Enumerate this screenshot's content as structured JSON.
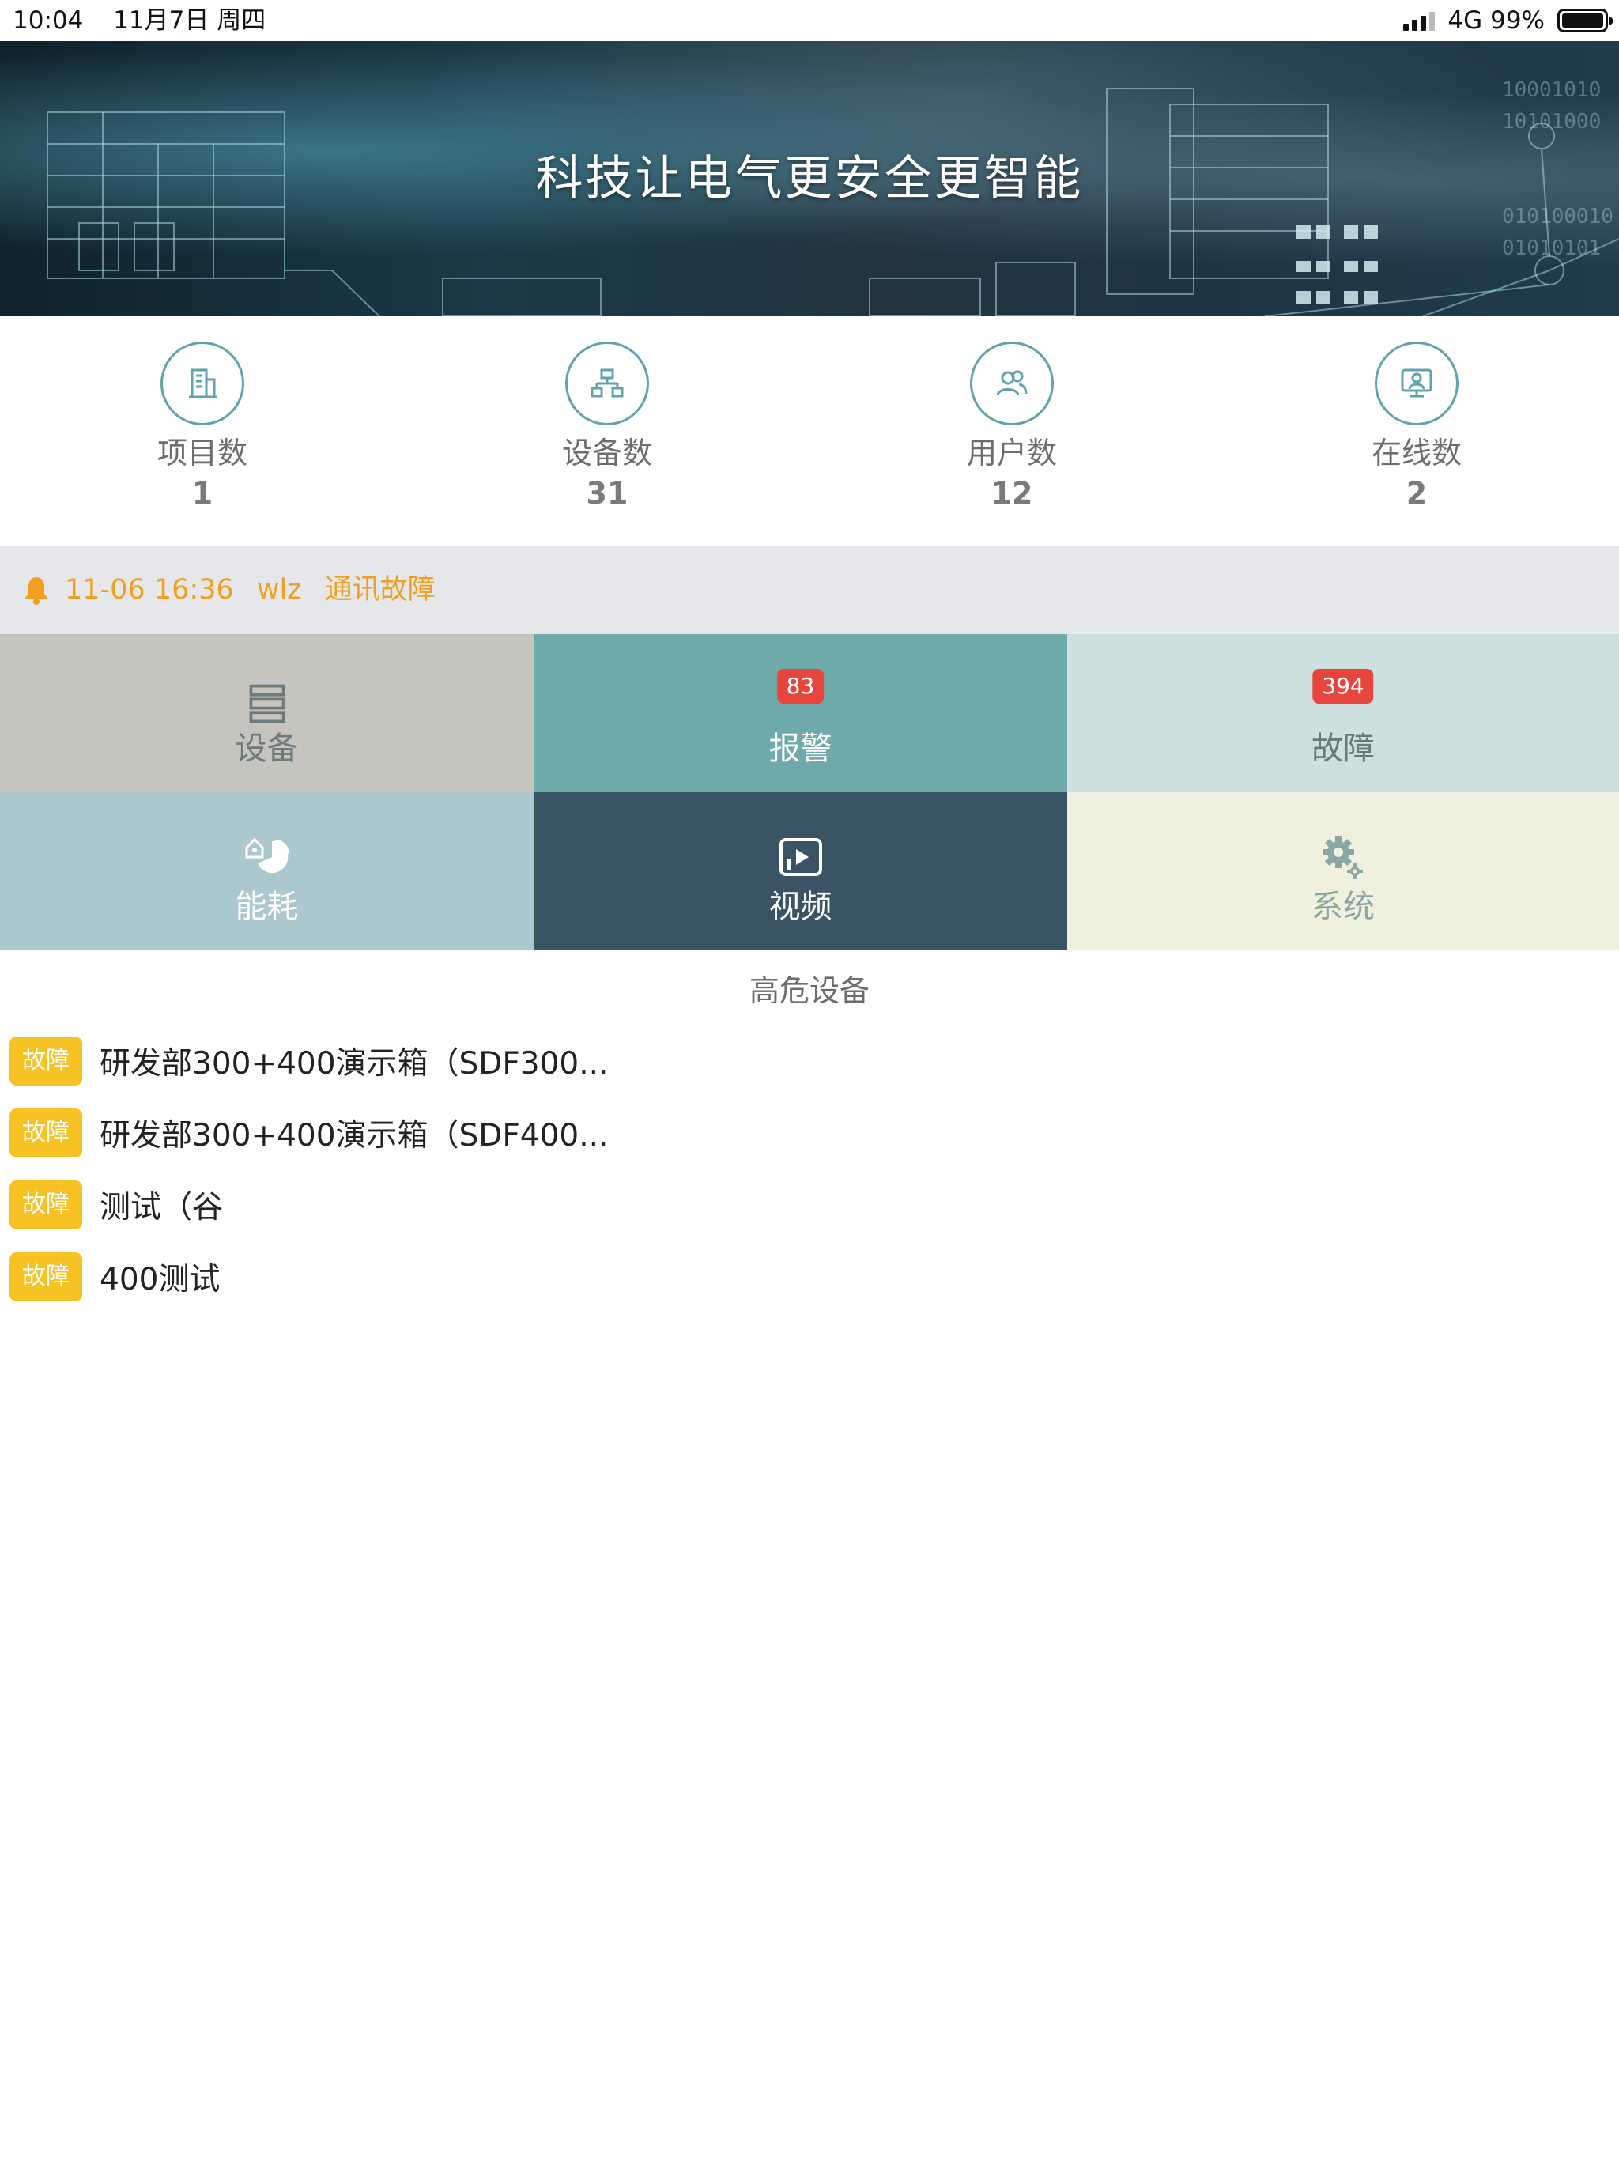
{
  "status_bar": {
    "time": "10:04",
    "date": "11月7日 周四",
    "network": "4G",
    "battery": "99%"
  },
  "banner": {
    "title": "科技让电气更安全更智能"
  },
  "stats": [
    {
      "icon": "building-icon",
      "label": "项目数",
      "value": "1"
    },
    {
      "icon": "network-tree-icon",
      "label": "设备数",
      "value": "31"
    },
    {
      "icon": "users-icon",
      "label": "用户数",
      "value": "12"
    },
    {
      "icon": "online-monitor-icon",
      "label": "在线数",
      "value": "2"
    }
  ],
  "alert": {
    "icon": "bell-icon",
    "time": "11-06 16:36",
    "user": "wlz",
    "message": "通讯故障"
  },
  "tiles": [
    {
      "label": "设备",
      "icon": "device-list-icon",
      "bg": "#c6c5bd",
      "fg": "#6f7b7b"
    },
    {
      "label": "报警",
      "badge": "83",
      "bg": "#6faaab",
      "fg": "#ffffff"
    },
    {
      "label": "故障",
      "badge": "394",
      "bg": "#cde0df",
      "fg": "#6a7878"
    },
    {
      "label": "能耗",
      "icon": "energy-pie-icon",
      "bg": "#abc8cf",
      "fg": "#ffffff"
    },
    {
      "label": "视频",
      "icon": "video-play-icon",
      "bg": "#3a5465",
      "fg": "#ffffff"
    },
    {
      "label": "系统",
      "icon": "settings-gear-icon",
      "bg": "#f0f0de",
      "fg": "#8aa7a4"
    }
  ],
  "high_risk": {
    "title": "高危设备",
    "items": [
      {
        "tag": "故障",
        "name": "研发部300+400演示箱（SDF300..."
      },
      {
        "tag": "故障",
        "name": "研发部300+400演示箱（SDF400..."
      },
      {
        "tag": "故障",
        "name": "测试（谷"
      },
      {
        "tag": "故障",
        "name": "400测试"
      }
    ]
  },
  "colors": {
    "accent": "#5fa3ab",
    "alert_text": "#f0a020",
    "badge": "#e8463c",
    "fault_tag": "#f7c223"
  }
}
